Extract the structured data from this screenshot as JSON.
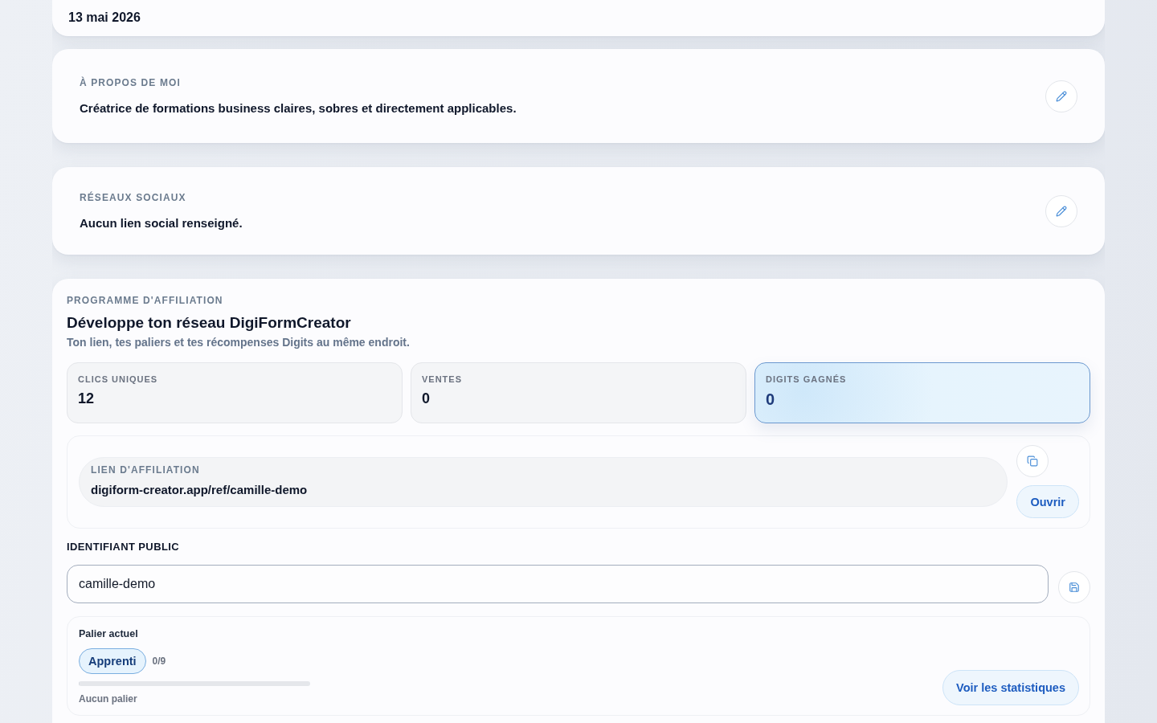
{
  "activation_card": {
    "date": "13 mai 2026"
  },
  "about_card": {
    "label": "À PROPOS DE MOI",
    "text": "Créatrice de formations business claires, sobres et directement applicables."
  },
  "socials_card": {
    "label": "RÉSEAUX SOCIAUX",
    "text": "Aucun lien social renseigné."
  },
  "affiliation": {
    "eyebrow": "PROGRAMME D'AFFILIATION",
    "title": "Développe ton réseau DigiFormCreator",
    "subtitle": "Ton lien, tes paliers et tes récompenses Digits au même endroit.",
    "stats": [
      {
        "label": "CLICS UNIQUES",
        "value": "12",
        "highlighted": false
      },
      {
        "label": "VENTES",
        "value": "0",
        "highlighted": false
      },
      {
        "label": "DIGITS GAGNÉS",
        "value": "0",
        "highlighted": true
      }
    ],
    "link": {
      "label": "LIEN D'AFFILIATION",
      "url": "digiform-creator.app/ref/camille-demo",
      "open_button": "Ouvrir"
    },
    "public_id": {
      "label": "IDENTIFIANT PUBLIC",
      "value": "camille-demo"
    },
    "tier": {
      "label": "Palier actuel",
      "badge": "Apprenti",
      "count": "0/9",
      "level": 0,
      "caption": "Aucun palier",
      "stats_button": "Voir les statistiques"
    }
  }
}
